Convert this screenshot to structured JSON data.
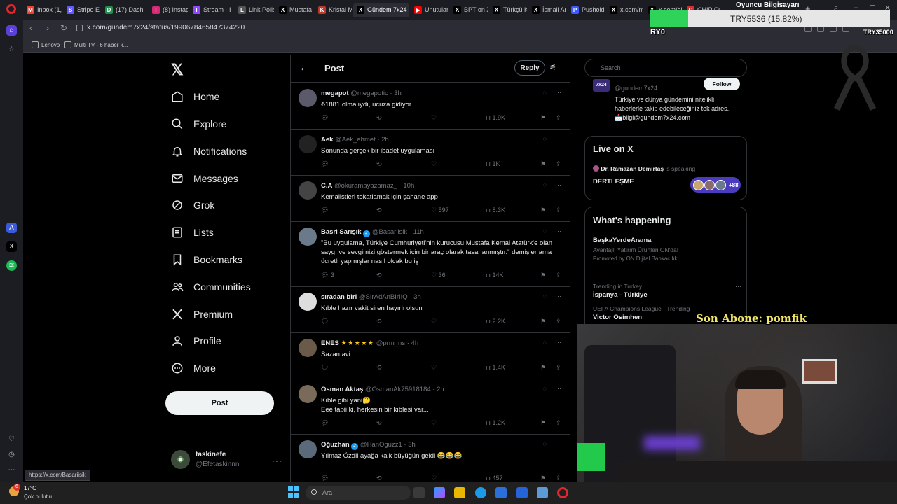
{
  "browser": {
    "tabs": [
      {
        "label": "Inbox (1,0",
        "color": "#ea4335",
        "glyph": "M"
      },
      {
        "label": "Stripe Exp",
        "color": "#635bff",
        "glyph": "S"
      },
      {
        "label": "(17) Dash",
        "color": "#1f8f4e",
        "glyph": "D"
      },
      {
        "label": "(8) Instag",
        "color": "#d62976",
        "glyph": "I"
      },
      {
        "label": "Stream - I",
        "color": "#9147ff",
        "glyph": "T"
      },
      {
        "label": "Link Polis",
        "color": "#555555",
        "glyph": "L"
      },
      {
        "label": "Mustafa D",
        "color": "#000000",
        "glyph": "X"
      },
      {
        "label": "Kristal M",
        "color": "#c0392b",
        "glyph": "K"
      },
      {
        "label": "Gündem 7x24 on",
        "color": "#000000",
        "glyph": "X",
        "active": true
      },
      {
        "label": "Unutulan",
        "color": "#ff0000",
        "glyph": "▶"
      },
      {
        "label": "BPT on X",
        "color": "#000000",
        "glyph": "X"
      },
      {
        "label": "Türkçü Ka",
        "color": "#000000",
        "glyph": "X"
      },
      {
        "label": "İsmail Ar",
        "color": "#000000",
        "glyph": "X"
      },
      {
        "label": "Pusholder",
        "color": "#3d5afe",
        "glyph": "P"
      },
      {
        "label": "x.com/m",
        "color": "#000000",
        "glyph": "X"
      },
      {
        "label": "x.com/ei",
        "color": "#000000",
        "glyph": "X"
      },
      {
        "label": "CHIP Onl",
        "color": "#d32f2f",
        "glyph": "C"
      }
    ],
    "url": "x.com/gundem7x24/status/1990678465847374220",
    "bookmarks": [
      "Lenovo",
      "Multi TV - 6 haber k..."
    ],
    "hover_url": "https://x.com/Basariisik"
  },
  "stream_overlay": {
    "title": "Oyuncu Bilgisayarı",
    "price_text": "TRY5536 (15.82%)",
    "progress_fraction": 0.1582,
    "left_label": "RY0",
    "right_label": "TRY35000",
    "subscriber_text": "Son Abone: pomfik"
  },
  "nav": {
    "items": [
      {
        "label": "Home",
        "icon": "home-icon"
      },
      {
        "label": "Explore",
        "icon": "search-icon"
      },
      {
        "label": "Notifications",
        "icon": "bell-icon"
      },
      {
        "label": "Messages",
        "icon": "mail-icon"
      },
      {
        "label": "Grok",
        "icon": "grok-icon"
      },
      {
        "label": "Lists",
        "icon": "list-icon"
      },
      {
        "label": "Bookmarks",
        "icon": "bookmark-icon"
      },
      {
        "label": "Communities",
        "icon": "people-icon"
      },
      {
        "label": "Premium",
        "icon": "x-logo-icon"
      },
      {
        "label": "Profile",
        "icon": "person-icon"
      },
      {
        "label": "More",
        "icon": "more-circle-icon"
      }
    ],
    "post_button": "Post",
    "account": {
      "name": "taskinefe",
      "handle": "@Efetaskinnn"
    }
  },
  "main": {
    "title": "Post",
    "reply_button": "Reply",
    "tweets": [
      {
        "name": "megapot",
        "handle": "@megapotic",
        "time": "3h",
        "text": "₺1881  olmalıydı, ucuza gidiyor",
        "likes": "",
        "views": "1.9K",
        "verified": false,
        "stars": ""
      },
      {
        "name": "Aek",
        "handle": "@Aek_ahmet",
        "time": "2h",
        "text": "Sonunda gerçek bir ibadet uygulaması",
        "likes": "",
        "views": "1K",
        "verified": false,
        "stars": ""
      },
      {
        "name": "C.A",
        "handle": "@okuramayazamaz_",
        "time": "10h",
        "text": "Kemalistleri tokatlamak için şahane app",
        "likes": "597",
        "views": "8.3K",
        "verified": false,
        "stars": ""
      },
      {
        "name": "Basri Sarışık",
        "handle": "@Basariisik",
        "time": "11h",
        "text": "\"Bu uygulama, Türkiye Cumhuriyeti'nin kurucusu Mustafa Kemal Atatürk'e olan saygı ve sevgimizi göstermek için bir araç olarak tasarlanmıştır.\" demişler ama ücretli yapmışlar nasıl olcak bu iş",
        "replies": "3",
        "likes": "36",
        "views": "14K",
        "verified": true,
        "stars": ""
      },
      {
        "name": "sıradan biri",
        "handle": "@SIrAdAnBIrIIQ",
        "time": "3h",
        "text": "Kıble hazır vakit siren hayırlı olsun",
        "likes": "",
        "views": "2.2K",
        "verified": false,
        "stars": ""
      },
      {
        "name": "ENES",
        "handle": "@prm_ns",
        "time": "4h",
        "text": "Sazan.avi",
        "likes": "",
        "views": "1.4K",
        "verified": false,
        "stars": "★★★★★"
      },
      {
        "name": "Osman Aktaş",
        "handle": "@OsmanAk75918184",
        "time": "2h",
        "text": "Kıble gibi yani🤔\nEee tabii ki, herkesin bir kıblesi var...",
        "likes": "",
        "views": "1.2K",
        "verified": false,
        "stars": ""
      },
      {
        "name": "Oğuzhan",
        "handle": "@HanOguzz1",
        "time": "3h",
        "text": "Yılmaz Özdil ayağa kalk büyüğün geldi 😂😂😂",
        "likes": "",
        "views": "457",
        "verified": true,
        "stars": ""
      }
    ]
  },
  "right": {
    "search_placeholder": "Search",
    "profile_card": {
      "handle": "@gundem7x24",
      "follow": "Follow",
      "bio": "Türkiye ve dünya gündemini nitelikli haberlerle takip edebileceğiniz tek adres.. 📩bilgi@gundem7x24.com"
    },
    "live": {
      "title": "Live on X",
      "host": "Dr. Ramazan Demirtaş",
      "host_suffix": "is speaking",
      "space_title": "DERTLEŞME",
      "listeners": "+88"
    },
    "happening": {
      "title": "What's happening",
      "items": [
        {
          "context": "",
          "title": "BaşkaYerdeArama",
          "sub": "Avantajlı Yatırım Ürünleri ON'da!",
          "promo": "Promoted by ON Dijital Bankacılık"
        },
        {
          "context": "Trending in Turkey",
          "title": "İspanya - Türkiye",
          "sub": "",
          "promo": ""
        },
        {
          "context": "UEFA Champions League · Trending",
          "title": "Victor Osimhen",
          "sub": "",
          "promo": ""
        }
      ]
    }
  },
  "taskbar": {
    "temperature": "17°C",
    "weather": "Çok bulutlu",
    "search_label": "Ara",
    "badge": "6"
  }
}
